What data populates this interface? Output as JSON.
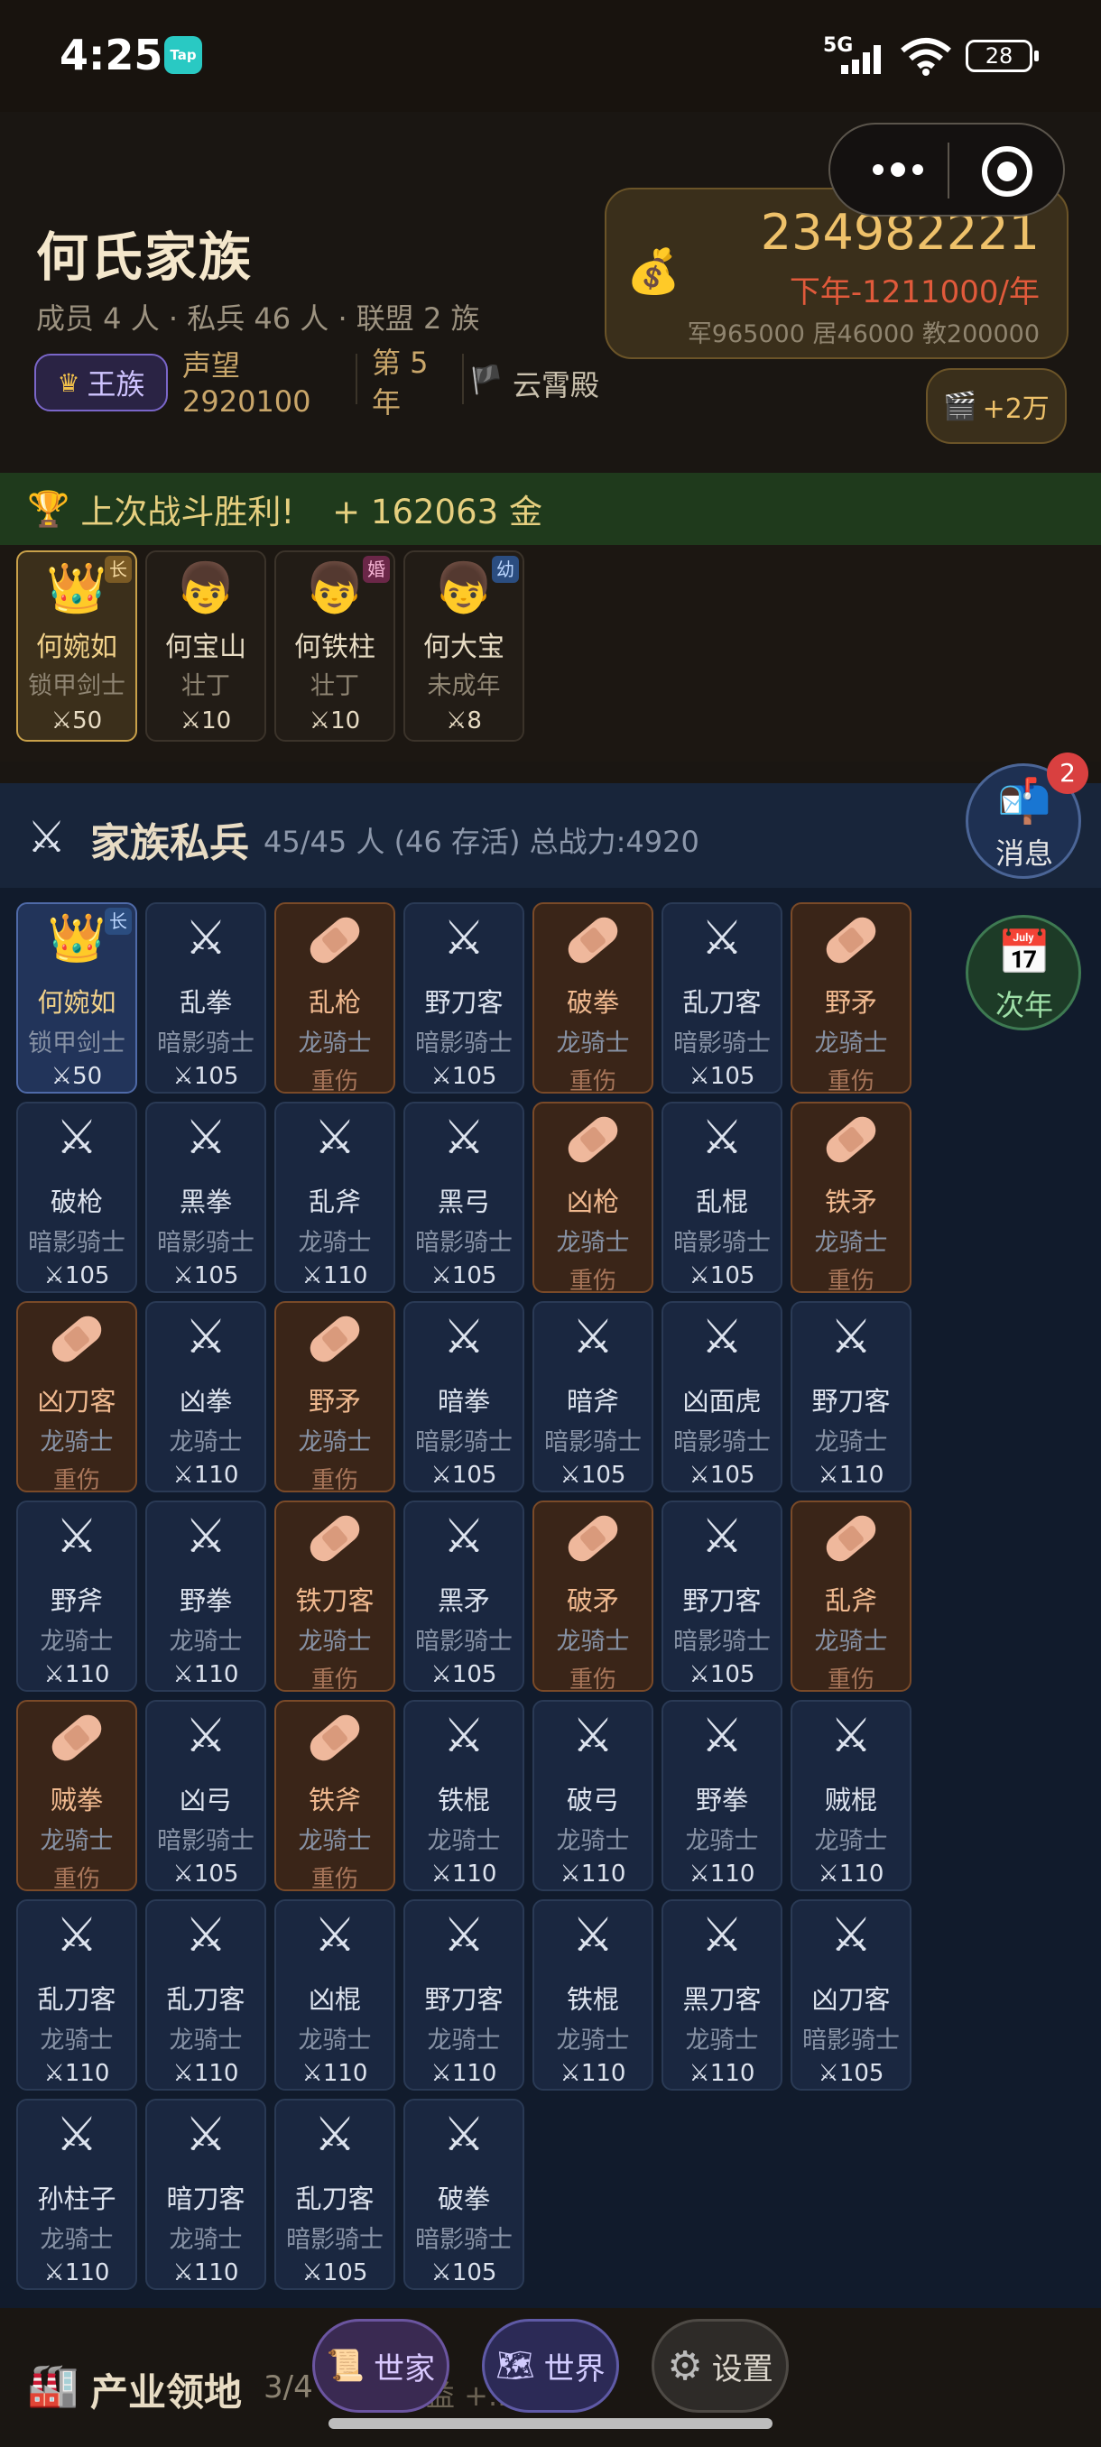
{
  "status_bar": {
    "time": "4:25",
    "tap_label": "Tap",
    "network": "5G",
    "battery": "28"
  },
  "family": {
    "name": "何氏家族",
    "stats": "成员 4 人 · 私兵 46 人 · 联盟 2 族",
    "rank_badge": "王族",
    "prestige_label": "声望",
    "prestige_value": "2920100",
    "year": "第 5 年",
    "hall": "云霄殿"
  },
  "gold": {
    "total": "234982221",
    "rate": "下年-1211000/年",
    "detail": "军965000 居46000 教200000"
  },
  "ad_button": "+2万",
  "victory": {
    "text": "上次战斗胜利!",
    "reward": "+ 162063 金"
  },
  "members": [
    {
      "name": "何婉如",
      "role": "锁甲剑士",
      "power": "⚔50",
      "tag": "长",
      "avatar": "👑"
    },
    {
      "name": "何宝山",
      "role": "壮丁",
      "power": "⚔10",
      "tag": "",
      "avatar": "👦"
    },
    {
      "name": "何铁柱",
      "role": "壮丁",
      "power": "⚔10",
      "tag": "婚",
      "avatar": "👦"
    },
    {
      "name": "何大宝",
      "role": "未成年",
      "power": "⚔8",
      "tag": "幼",
      "avatar": "👦"
    }
  ],
  "troops": {
    "title": "家族私兵",
    "summary": "45/45 人 (46 存活) 总战力:4920",
    "list": [
      {
        "name": "何婉如",
        "role": "锁甲剑士",
        "status": "⚔50",
        "injured": false,
        "leader": true,
        "tag": "长"
      },
      {
        "name": "乱拳",
        "role": "暗影骑士",
        "status": "⚔105",
        "injured": false
      },
      {
        "name": "乱枪",
        "role": "龙骑士",
        "status": "重伤",
        "injured": true
      },
      {
        "name": "野刀客",
        "role": "暗影骑士",
        "status": "⚔105",
        "injured": false
      },
      {
        "name": "破拳",
        "role": "龙骑士",
        "status": "重伤",
        "injured": true
      },
      {
        "name": "乱刀客",
        "role": "暗影骑士",
        "status": "⚔105",
        "injured": false
      },
      {
        "name": "野矛",
        "role": "龙骑士",
        "status": "重伤",
        "injured": true
      },
      {
        "name": "破枪",
        "role": "暗影骑士",
        "status": "⚔105",
        "injured": false
      },
      {
        "name": "黑拳",
        "role": "暗影骑士",
        "status": "⚔105",
        "injured": false
      },
      {
        "name": "乱斧",
        "role": "龙骑士",
        "status": "⚔110",
        "injured": false
      },
      {
        "name": "黑弓",
        "role": "暗影骑士",
        "status": "⚔105",
        "injured": false
      },
      {
        "name": "凶枪",
        "role": "龙骑士",
        "status": "重伤",
        "injured": true
      },
      {
        "name": "乱棍",
        "role": "暗影骑士",
        "status": "⚔105",
        "injured": false
      },
      {
        "name": "铁矛",
        "role": "龙骑士",
        "status": "重伤",
        "injured": true
      },
      {
        "name": "凶刀客",
        "role": "龙骑士",
        "status": "重伤",
        "injured": true
      },
      {
        "name": "凶拳",
        "role": "龙骑士",
        "status": "⚔110",
        "injured": false
      },
      {
        "name": "野矛",
        "role": "龙骑士",
        "status": "重伤",
        "injured": true
      },
      {
        "name": "暗拳",
        "role": "暗影骑士",
        "status": "⚔105",
        "injured": false
      },
      {
        "name": "暗斧",
        "role": "暗影骑士",
        "status": "⚔105",
        "injured": false
      },
      {
        "name": "凶面虎",
        "role": "暗影骑士",
        "status": "⚔105",
        "injured": false
      },
      {
        "name": "野刀客",
        "role": "龙骑士",
        "status": "⚔110",
        "injured": false
      },
      {
        "name": "野斧",
        "role": "龙骑士",
        "status": "⚔110",
        "injured": false
      },
      {
        "name": "野拳",
        "role": "龙骑士",
        "status": "⚔110",
        "injured": false
      },
      {
        "name": "铁刀客",
        "role": "龙骑士",
        "status": "重伤",
        "injured": true
      },
      {
        "name": "黑矛",
        "role": "暗影骑士",
        "status": "⚔105",
        "injured": false
      },
      {
        "name": "破矛",
        "role": "龙骑士",
        "status": "重伤",
        "injured": true
      },
      {
        "name": "野刀客",
        "role": "暗影骑士",
        "status": "⚔105",
        "injured": false
      },
      {
        "name": "乱斧",
        "role": "龙骑士",
        "status": "重伤",
        "injured": true
      },
      {
        "name": "贼拳",
        "role": "龙骑士",
        "status": "重伤",
        "injured": true
      },
      {
        "name": "凶弓",
        "role": "暗影骑士",
        "status": "⚔105",
        "injured": false
      },
      {
        "name": "铁斧",
        "role": "龙骑士",
        "status": "重伤",
        "injured": true
      },
      {
        "name": "铁棍",
        "role": "龙骑士",
        "status": "⚔110",
        "injured": false
      },
      {
        "name": "破弓",
        "role": "龙骑士",
        "status": "⚔110",
        "injured": false
      },
      {
        "name": "野拳",
        "role": "龙骑士",
        "status": "⚔110",
        "injured": false
      },
      {
        "name": "贼棍",
        "role": "龙骑士",
        "status": "⚔110",
        "injured": false
      },
      {
        "name": "乱刀客",
        "role": "龙骑士",
        "status": "⚔110",
        "injured": false
      },
      {
        "name": "乱刀客",
        "role": "龙骑士",
        "status": "⚔110",
        "injured": false
      },
      {
        "name": "凶棍",
        "role": "龙骑士",
        "status": "⚔110",
        "injured": false
      },
      {
        "name": "野刀客",
        "role": "龙骑士",
        "status": "⚔110",
        "injured": false
      },
      {
        "name": "铁棍",
        "role": "龙骑士",
        "status": "⚔110",
        "injured": false
      },
      {
        "name": "黑刀客",
        "role": "龙骑士",
        "status": "⚔110",
        "injured": false
      },
      {
        "name": "凶刀客",
        "role": "暗影骑士",
        "status": "⚔105",
        "injured": false
      },
      {
        "name": "孙柱子",
        "role": "龙骑士",
        "status": "⚔110",
        "injured": false
      },
      {
        "name": "暗刀客",
        "role": "龙骑士",
        "status": "⚔110",
        "injured": false
      },
      {
        "name": "乱刀客",
        "role": "暗影骑士",
        "status": "⚔105",
        "injured": false
      },
      {
        "name": "破拳",
        "role": "暗影骑士",
        "status": "⚔105",
        "injured": false
      }
    ]
  },
  "side_buttons": {
    "messages": "消息",
    "message_badge": "2",
    "next_year": "次年"
  },
  "industry": {
    "title": "产业领地",
    "count": "3/4",
    "income": "收益 +...../年"
  },
  "nav": {
    "family": "世家",
    "world": "世界",
    "settings": "设置"
  },
  "icons": {
    "troop": "crossed-swords-icon",
    "injured": "bandage-icon",
    "leader": "crown-icon",
    "money": "money-bag-icon",
    "trophy": "trophy-icon",
    "ad": "clapper-board-icon",
    "messages": "mailbox-icon",
    "calendar": "calendar-icon",
    "factory": "factory-icon",
    "scroll": "scroll-icon",
    "world_map": "world-map-icon",
    "settings": "gear-icon"
  },
  "colors": {
    "gold": "#eec16a",
    "deficit": "#e15a3b",
    "victory_bg": "#1f3a1c",
    "troops_bg": "#111b2c",
    "injured_bg": "#3a2518"
  }
}
